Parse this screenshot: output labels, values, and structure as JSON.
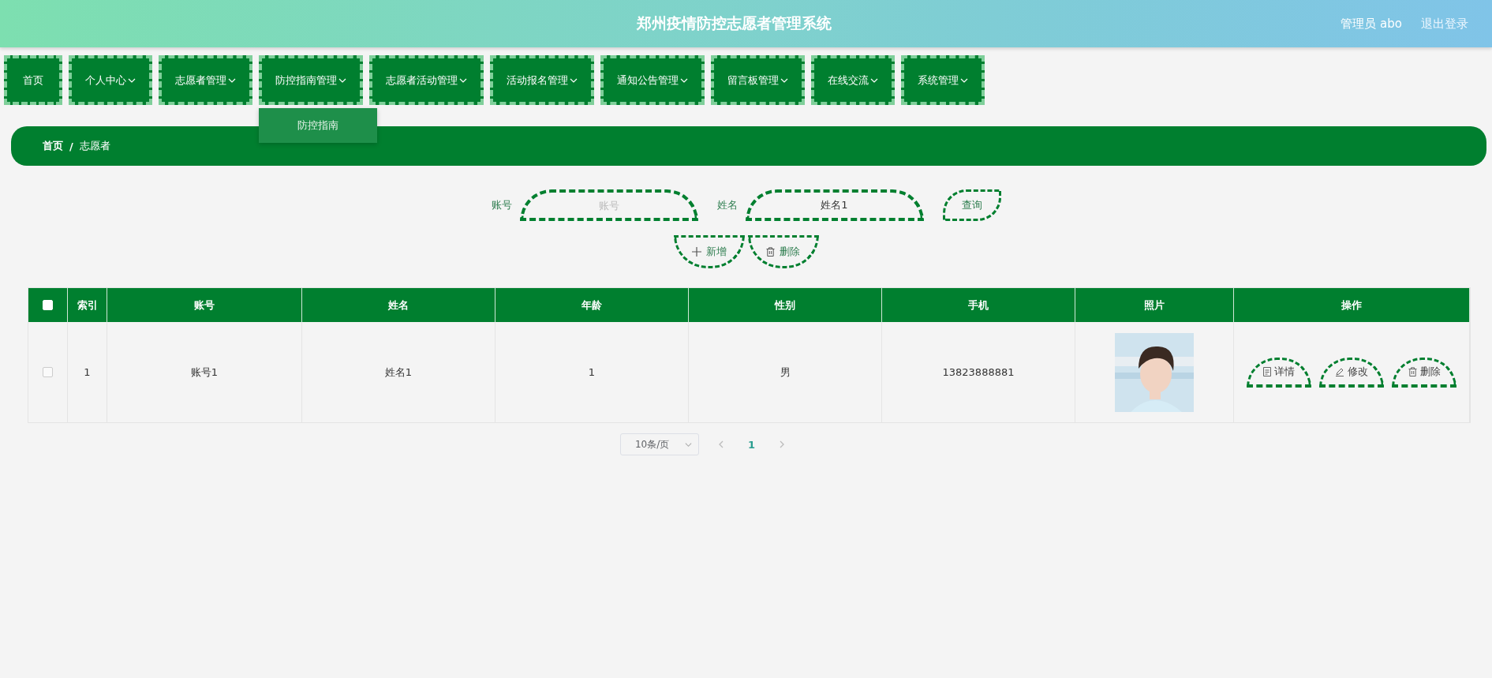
{
  "header": {
    "title": "郑州疫情防控志愿者管理系统",
    "user": "管理员 abo",
    "logout": "退出登录"
  },
  "nav": [
    {
      "label": "首页",
      "dropdown": false
    },
    {
      "label": "个人中心",
      "dropdown": true
    },
    {
      "label": "志愿者管理",
      "dropdown": true
    },
    {
      "label": "防控指南管理",
      "dropdown": true,
      "menu": [
        "防控指南"
      ]
    },
    {
      "label": "志愿者活动管理",
      "dropdown": true
    },
    {
      "label": "活动报名管理",
      "dropdown": true
    },
    {
      "label": "通知公告管理",
      "dropdown": true
    },
    {
      "label": "留言板管理",
      "dropdown": true
    },
    {
      "label": "在线交流",
      "dropdown": true
    },
    {
      "label": "系统管理",
      "dropdown": true
    }
  ],
  "breadcrumb": {
    "separator": "/",
    "items": [
      "首页",
      "志愿者"
    ]
  },
  "search": {
    "fields": [
      {
        "label": "账号",
        "placeholder": "账号"
      },
      {
        "label": "姓名",
        "value": "姓名1"
      }
    ],
    "button": "查询"
  },
  "actions": [
    {
      "kind": "add",
      "label": "新增"
    },
    {
      "kind": "delete",
      "label": "删除"
    }
  ],
  "table": {
    "select_all_checked": false,
    "columns": [
      "索引",
      "账号",
      "姓名",
      "年龄",
      "性别",
      "手机",
      "照片",
      "操作"
    ],
    "rows": [
      {
        "checked": false,
        "cells": [
          "1",
          "账号1",
          "姓名1",
          "1",
          "男",
          "13823888881"
        ],
        "actions": [
          {
            "kind": "detail",
            "label": "详情"
          },
          {
            "kind": "edit",
            "label": "修改"
          },
          {
            "kind": "delete",
            "label": "删除"
          }
        ]
      }
    ]
  },
  "pagination": {
    "page_size": "10条/页",
    "pages": [
      {
        "label": "1",
        "selected": true
      }
    ]
  }
}
